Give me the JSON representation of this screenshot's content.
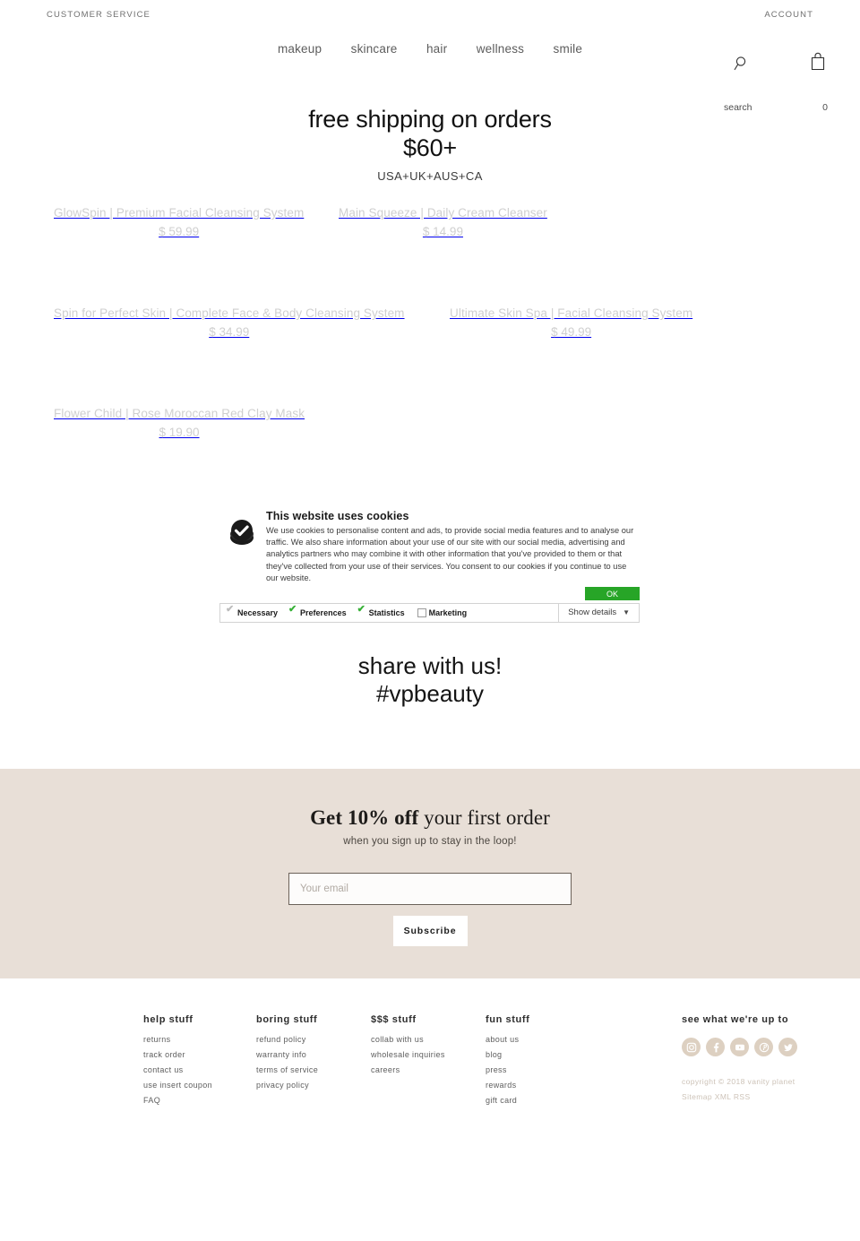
{
  "utility_bar": {
    "customer_service": "CUSTOMER SERVICE",
    "account": "ACCOUNT"
  },
  "nav": {
    "items": [
      {
        "label": "makeup"
      },
      {
        "label": "skincare"
      },
      {
        "label": "hair"
      },
      {
        "label": "wellness"
      },
      {
        "label": "smile"
      }
    ]
  },
  "header_icons": {
    "search_icon": "search-icon",
    "search_label": "search",
    "cart_icon": "shopping-bag-icon",
    "cart_count": "0"
  },
  "promo": {
    "line1": "free shipping on orders",
    "line2": "$60+",
    "subtitle": "USA+UK+AUS+CA"
  },
  "products": [
    [
      {
        "title": "GlowSpin | Premium Facial Cleansing System",
        "price": "$ 59.99"
      },
      {
        "title": "Main Squeeze | Daily Cream Cleanser",
        "price": "$ 14.99"
      }
    ],
    [
      {
        "title": "Spin for Perfect Skin | Complete Face & Body Cleansing System",
        "price": "$ 34.99"
      },
      {
        "title": "Ultimate Skin Spa | Facial Cleansing System",
        "price": "$ 49.99"
      }
    ],
    [
      {
        "title": "Flower Child | Rose Moroccan Red Clay Mask",
        "price": "$ 19.90"
      }
    ]
  ],
  "cookie_banner": {
    "icon": "cookie-consent-check-icon",
    "heading": "This website uses cookies",
    "body": "We use cookies to personalise content and ads, to provide social media features and to analyse our traffic. We also share information about your use of our site with our social media, advertising and analytics partners who may combine it with other information that you've provided to them or that they've collected from your use of their services. You consent to our cookies if you continue to use our website.",
    "ok_label": "OK",
    "show_details_label": "Show details",
    "chevron": "⌄",
    "ok_color": "#27a527",
    "check_color": "#35b035",
    "categories": [
      {
        "label": "Necessary",
        "state": "checked-grey"
      },
      {
        "label": "Preferences",
        "state": "checked-green"
      },
      {
        "label": "Statistics",
        "state": "checked-green"
      },
      {
        "label": "Marketing",
        "state": "unchecked"
      }
    ]
  },
  "share": {
    "line1": "share with us!",
    "line2": "#vpbeauty"
  },
  "newsletter": {
    "heading_strong": "Get 10% off",
    "heading_rest": " your first order",
    "subtitle": "when you sign up to stay in the loop!",
    "email_placeholder": "Your email",
    "email_value": "",
    "submit_label": "Subscribe",
    "background_color": "#e8dfd7"
  },
  "footer": {
    "columns": [
      {
        "heading": "help stuff",
        "links": [
          "returns",
          "track order",
          "contact us",
          "use insert coupon",
          "FAQ"
        ]
      },
      {
        "heading": "boring stuff",
        "links": [
          "refund policy",
          "warranty info",
          "terms of service",
          "privacy policy"
        ]
      },
      {
        "heading": "$$$ stuff",
        "links": [
          "collab with us",
          "wholesale inquiries",
          "careers"
        ]
      },
      {
        "heading": "fun stuff",
        "links": [
          "about us",
          "blog",
          "press",
          "rewards",
          "gift card"
        ]
      }
    ],
    "social": {
      "heading": "see what we're up to",
      "icons": [
        "instagram-icon",
        "facebook-icon",
        "youtube-icon",
        "pinterest-icon",
        "twitter-icon"
      ],
      "icon_color": "#ddd0c1"
    },
    "copyright": "copyright © 2018 vanity planet",
    "sitemap": "Sitemap XML RSS"
  }
}
